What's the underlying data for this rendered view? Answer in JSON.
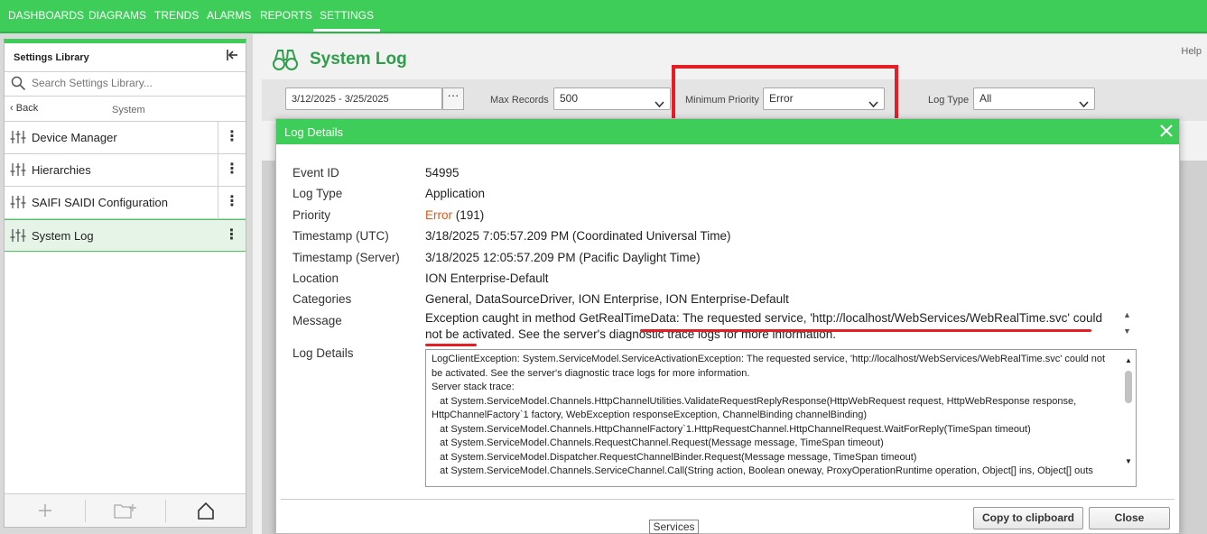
{
  "nav": {
    "items": [
      "DASHBOARDS",
      "DIAGRAMS",
      "TRENDS",
      "ALARMS",
      "REPORTS",
      "SETTINGS"
    ],
    "active": "SETTINGS"
  },
  "sidebar": {
    "title": "Settings Library",
    "search_placeholder": "Search Settings Library...",
    "back_label": "Back",
    "current_group": "System",
    "items": [
      {
        "label": "Device Manager"
      },
      {
        "label": "Hierarchies"
      },
      {
        "label": "SAIFI SAIDI Configuration"
      },
      {
        "label": "System Log"
      }
    ],
    "active_item": "System Log"
  },
  "main": {
    "title": "System Log",
    "help": "Help",
    "filters": {
      "date_range": "3/12/2025 - 3/25/2025",
      "date_button": "···",
      "max_records_label": "Max Records",
      "max_records_value": "500",
      "min_priority_label": "Minimum Priority",
      "min_priority_value": "Error",
      "log_type_label": "Log Type",
      "log_type_value": "All"
    }
  },
  "modal": {
    "title": "Log Details",
    "fields": [
      {
        "label": "Event ID",
        "value": "54995"
      },
      {
        "label": "Log Type",
        "value": "Application"
      },
      {
        "label": "Priority",
        "value_error": "Error",
        "value_rest": " (191)"
      },
      {
        "label": "Timestamp (UTC)",
        "value": "3/18/2025 7:05:57.209 PM (Coordinated Universal Time)"
      },
      {
        "label": "Timestamp (Server)",
        "value": "3/18/2025 12:05:57.209 PM (Pacific Daylight Time)"
      },
      {
        "label": "Location",
        "value": "ION Enterprise-Default"
      },
      {
        "label": "Categories",
        "value": "General, DataSourceDriver, ION Enterprise, ION Enterprise-Default"
      },
      {
        "label": "Message",
        "value": ""
      },
      {
        "label": "Log Details",
        "value": ""
      }
    ],
    "message": "Exception caught in method GetRealTimeData: The requested service, 'http://localhost/WebServices/WebRealTime.svc' could not be activated. See the server's diagnostic trace logs for more information.",
    "details_lines": [
      "LogClientException: System.ServiceModel.ServiceActivationException: The requested service, 'http://localhost/WebServices/WebRealTime.svc' could not be activated. See the server's diagnostic trace logs for more information.",
      "",
      "Server stack trace:",
      "   at System.ServiceModel.Channels.HttpChannelUtilities.ValidateRequestReplyResponse(HttpWebRequest request, HttpWebResponse response, HttpChannelFactory`1 factory, WebException responseException, ChannelBinding channelBinding)",
      "   at System.ServiceModel.Channels.HttpChannelFactory`1.HttpRequestChannel.HttpChannelRequest.WaitForReply(TimeSpan timeout)",
      "   at System.ServiceModel.Channels.RequestChannel.Request(Message message, TimeSpan timeout)",
      "   at System.ServiceModel.Dispatcher.RequestChannelBinder.Request(Message message, TimeSpan timeout)",
      "   at System.ServiceModel.Channels.ServiceChannel.Call(String action, Boolean oneway, ProxyOperationRuntime operation, Object[] ins, Object[] outs"
    ],
    "copy_button": "Copy to clipboard",
    "close_button": "Close"
  },
  "tooltip": "Services",
  "colors": {
    "brand_green": "#3dcd58",
    "title_green": "#2e9e4a",
    "error_orange": "#e0591b",
    "annotation_red": "#e51e25"
  }
}
